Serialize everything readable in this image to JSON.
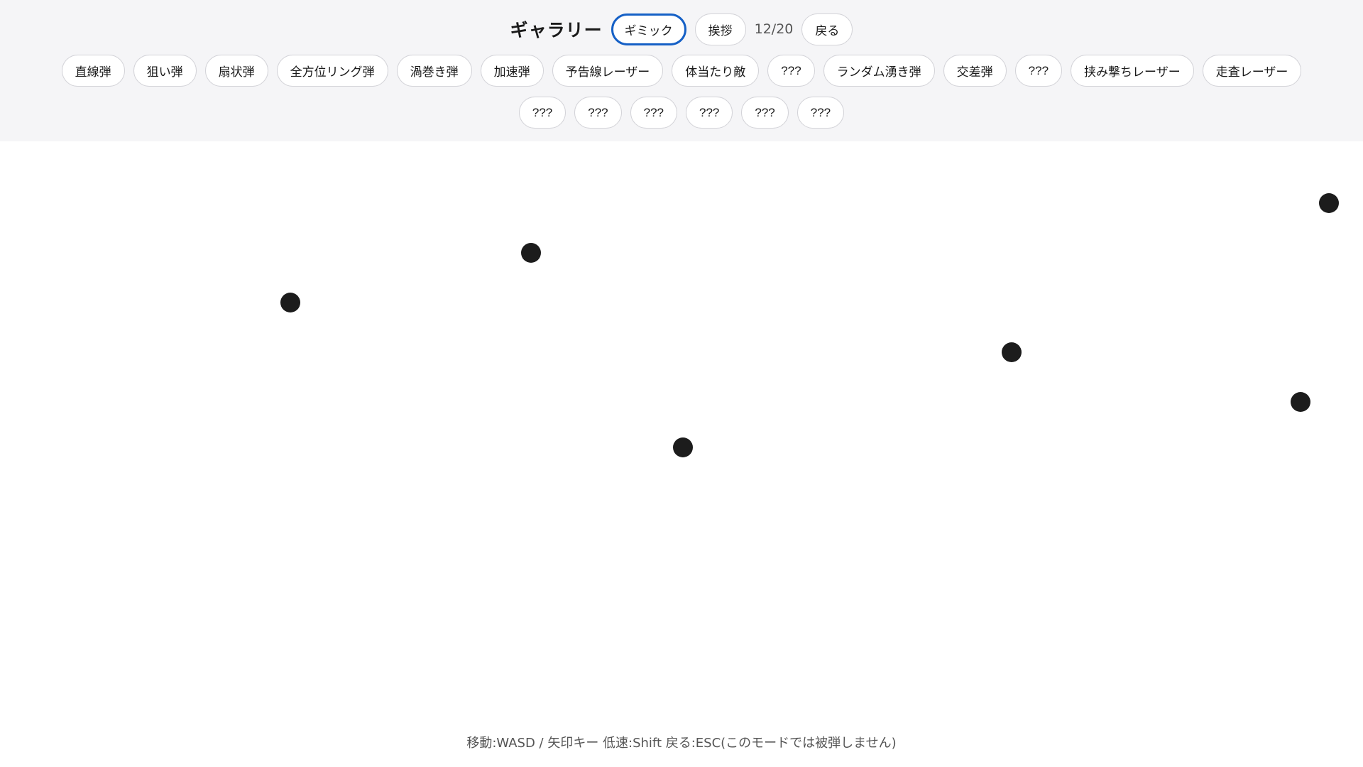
{
  "header": {
    "title": "ギャラリー",
    "mode_button": "ギミック",
    "greeting_button": "挨拶",
    "counter": "12/20",
    "back_button": "戻る"
  },
  "patterns": {
    "row1": [
      {
        "label": "直線弾",
        "selected": true
      },
      {
        "label": "狙い弾",
        "selected": false
      },
      {
        "label": "扇状弾",
        "selected": false
      },
      {
        "label": "全方位リング弾",
        "selected": false
      },
      {
        "label": "渦巻き弾",
        "selected": false
      },
      {
        "label": "加速弾",
        "selected": false
      },
      {
        "label": "予告線レーザー",
        "selected": false
      },
      {
        "label": "体当たり敵",
        "selected": false
      },
      {
        "label": "???",
        "selected": false
      },
      {
        "label": "ランダム湧き弾",
        "selected": false
      },
      {
        "label": "交差弾",
        "selected": false
      },
      {
        "label": "???",
        "selected": false
      },
      {
        "label": "挟み撃ちレーザー",
        "selected": false
      },
      {
        "label": "走査レーザー",
        "selected": false
      }
    ],
    "row2": [
      {
        "label": "???",
        "selected": false
      },
      {
        "label": "???",
        "selected": false
      },
      {
        "label": "???",
        "selected": false
      },
      {
        "label": "???",
        "selected": false
      },
      {
        "label": "???",
        "selected": false
      },
      {
        "label": "???",
        "selected": false
      }
    ]
  },
  "footer": {
    "help_text": "移動:WASD / 矢印キー 低速:Shift 戻る:ESC(このモードでは被弾しません)"
  },
  "colors": {
    "accent": "#1560c6",
    "bullet": "#1c1c1c",
    "header_bg": "#f5f5f7"
  }
}
